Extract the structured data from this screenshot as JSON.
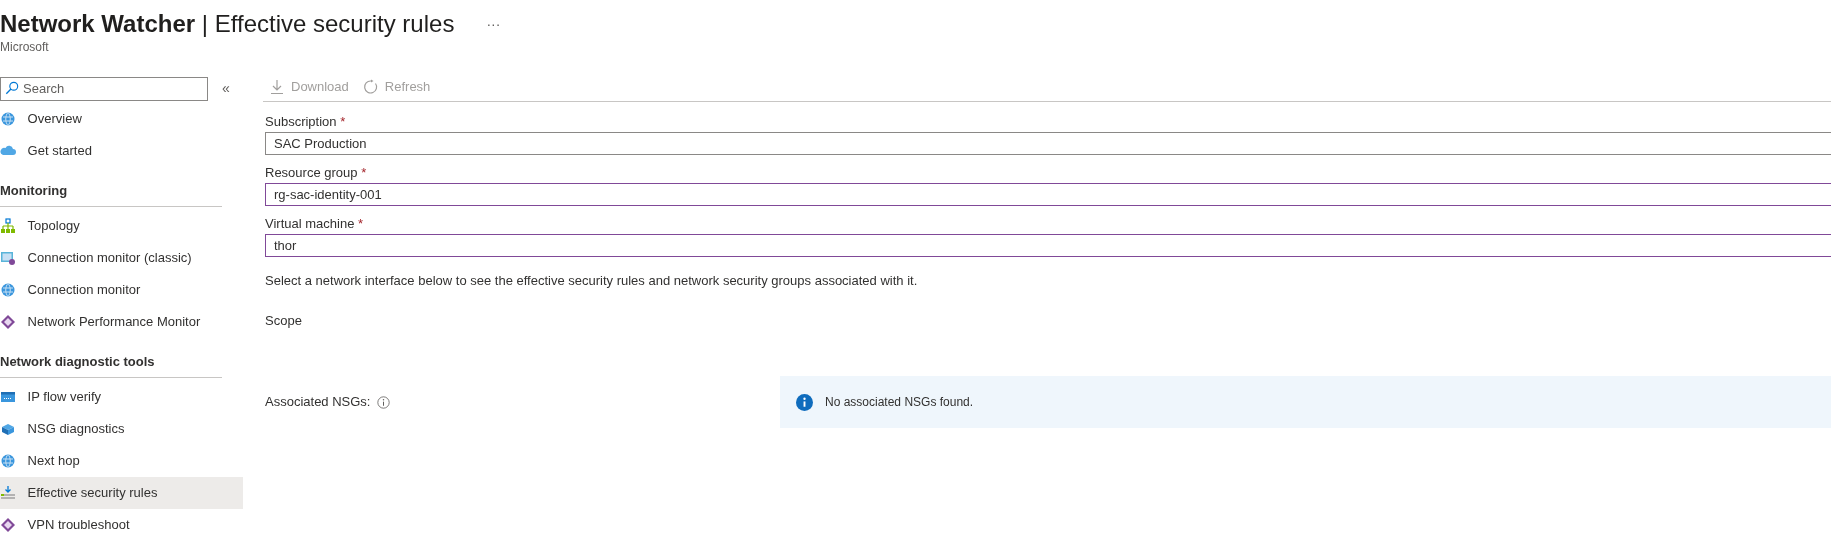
{
  "header": {
    "title": "Network Watcher",
    "separator": "|",
    "subtitle": "Effective security rules",
    "publisher": "Microsoft",
    "more": "···"
  },
  "sidebar": {
    "search": {
      "placeholder": "Search"
    },
    "collapse": "«",
    "items": [
      {
        "kind": "item",
        "label": "Overview",
        "selected": false
      },
      {
        "kind": "item",
        "label": "Get started",
        "selected": false
      },
      {
        "kind": "section",
        "label": "Monitoring"
      },
      {
        "kind": "item",
        "label": "Topology",
        "selected": false
      },
      {
        "kind": "item",
        "label": "Connection monitor (classic)",
        "selected": false
      },
      {
        "kind": "item",
        "label": "Connection monitor",
        "selected": false
      },
      {
        "kind": "item",
        "label": "Network Performance Monitor",
        "selected": false
      },
      {
        "kind": "section",
        "label": "Network diagnostic tools"
      },
      {
        "kind": "item",
        "label": "IP flow verify",
        "selected": false
      },
      {
        "kind": "item",
        "label": "NSG diagnostics",
        "selected": false
      },
      {
        "kind": "item",
        "label": "Next hop",
        "selected": false
      },
      {
        "kind": "item",
        "label": "Effective security rules",
        "selected": true
      },
      {
        "kind": "item",
        "label": "VPN troubleshoot",
        "selected": false
      }
    ]
  },
  "toolbar": [
    {
      "label": "Download",
      "disabled": true
    },
    {
      "label": "Refresh",
      "disabled": true
    }
  ],
  "fields": [
    {
      "label": "Subscription",
      "required": true,
      "value": "SAC Production",
      "focused": false
    },
    {
      "label": "Resource group",
      "required": true,
      "value": "rg-sac-identity-001",
      "focused": true
    },
    {
      "label": "Virtual machine",
      "required": true,
      "value": "thor",
      "focused": true
    }
  ],
  "required_mark": "*",
  "description": "Select a network interface below to see the effective security rules and network security groups associated with it.",
  "scope_label": "Scope",
  "associated_label": "Associated NSGs:",
  "info_message": "No associated NSGs found."
}
